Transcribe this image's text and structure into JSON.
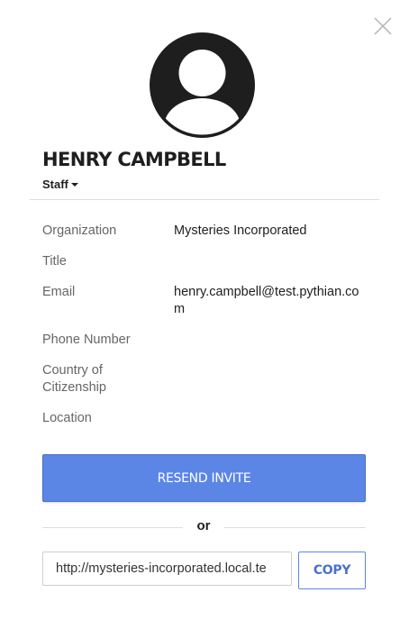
{
  "profile": {
    "name": "HENRY CAMPBELL",
    "role": "Staff"
  },
  "fields": {
    "organization": {
      "label": "Organization",
      "value": "Mysteries Incorporated"
    },
    "title": {
      "label": "Title",
      "value": ""
    },
    "email": {
      "label": "Email",
      "value": "henry.campbell@test.pythian.com"
    },
    "phone": {
      "label": "Phone Number",
      "value": ""
    },
    "citizenship": {
      "label": "Country of Citizenship",
      "value": ""
    },
    "location": {
      "label": "Location",
      "value": ""
    }
  },
  "actions": {
    "resend_label": "RESEND INVITE",
    "or_label": "or",
    "invite_link": "http://mysteries-incorporated.local.te",
    "copy_label": "COPY"
  },
  "icons": {
    "close": "close-icon",
    "avatar": "avatar-person-icon",
    "caret": "caret-down-icon"
  },
  "colors": {
    "accent": "#5b86e5",
    "text_dark": "#1e1e1e",
    "label_gray": "#666666"
  }
}
